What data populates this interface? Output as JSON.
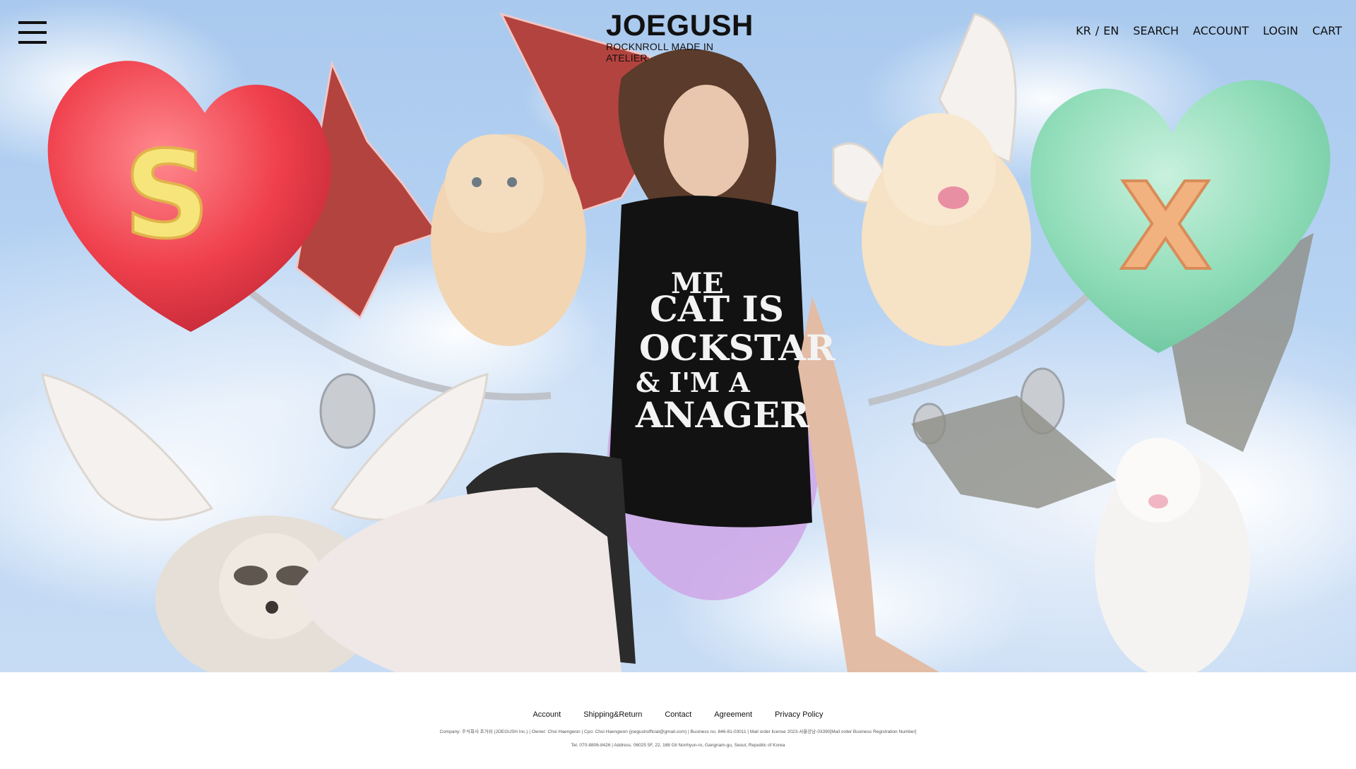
{
  "brand": {
    "name": "JOEGUSH",
    "tagline": "ROCKNROLL MADE IN ATELIER"
  },
  "nav": {
    "lang_kr": "KR",
    "lang_sep": "/",
    "lang_en": "EN",
    "search": "SEARCH",
    "account": "ACCOUNT",
    "login": "LOGIN",
    "cart": "CART"
  },
  "hero": {
    "heart_left_letter": "S",
    "heart_right_letter": "X",
    "shirt_lines": [
      "ME",
      "CAT IS",
      "OCKSTAR",
      "& I'M A",
      "ANAGER"
    ]
  },
  "footer": {
    "links": [
      "Account",
      "Shipping&Return",
      "Contact",
      "Agreement",
      "Privacy Policy"
    ],
    "company_line": "Company: 주식회사 조거쉬 (JOEGUSH Inc.) | Owner: Choi Haengwon | Cpo: Choi Haengwon (joegushofficial@gmail.com) | Business no. 646-81-03011 | Mail order license 2023-서울강남-03390[Mail order Business Registration Number]",
    "address_line": "Tel. 070-8806-8426 | Address. 06025 5F, 22, 168 Gil Nonhyun-ro, Gangnam-gu, Seoul, Republic of Korea"
  },
  "colors": {
    "sky": "#b7d3f3",
    "heart_left": "#f0505a",
    "heart_right": "#8fdcb8",
    "text": "#111111"
  }
}
